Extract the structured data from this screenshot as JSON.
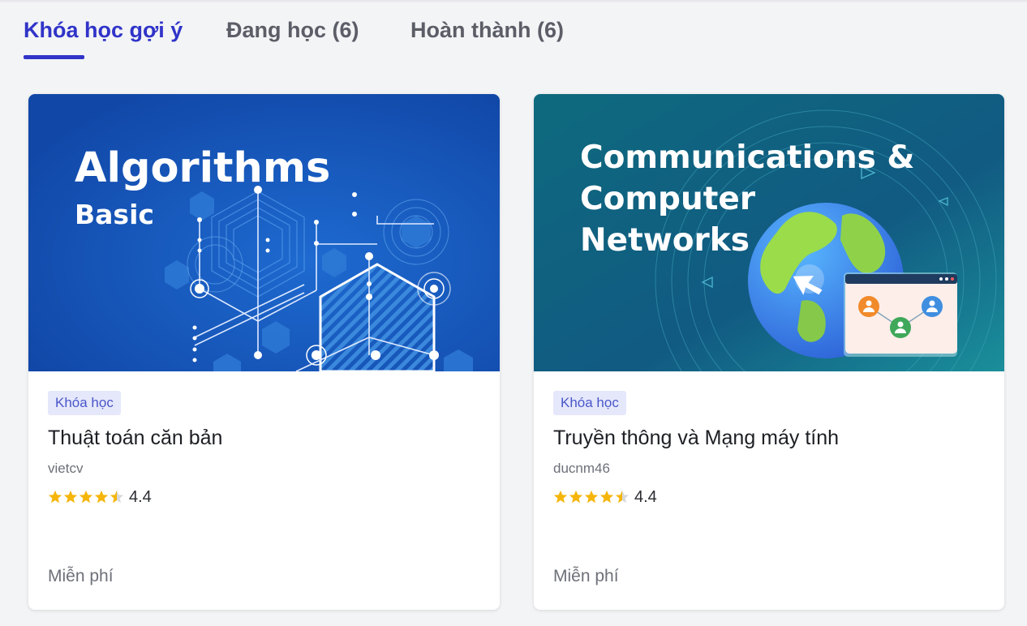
{
  "tabs": [
    {
      "label": "Khóa học gợi ý",
      "active": true
    },
    {
      "label": "Đang học (6)",
      "active": false
    },
    {
      "label": "Hoàn thành (6)",
      "active": false
    }
  ],
  "colors": {
    "accent": "#3034c8",
    "star": "#f5b50a",
    "badge_bg": "#e5e8fb",
    "badge_text": "#4a56c9"
  },
  "courses": [
    {
      "image": {
        "line1": "Algorithms",
        "line2": "Basic",
        "bg": "#1552b8"
      },
      "badge": "Khóa học",
      "title": "Thuật toán căn bản",
      "author": "vietcv",
      "rating": "4.4",
      "price": "Miễn phí"
    },
    {
      "image": {
        "line1": "Communications &",
        "line2": "Computer",
        "line3": "Networks",
        "bg": "#0f5f7a"
      },
      "badge": "Khóa học",
      "title": "Truyền thông và Mạng máy tính",
      "author": "ducnm46",
      "rating": "4.4",
      "price": "Miễn phí"
    }
  ]
}
